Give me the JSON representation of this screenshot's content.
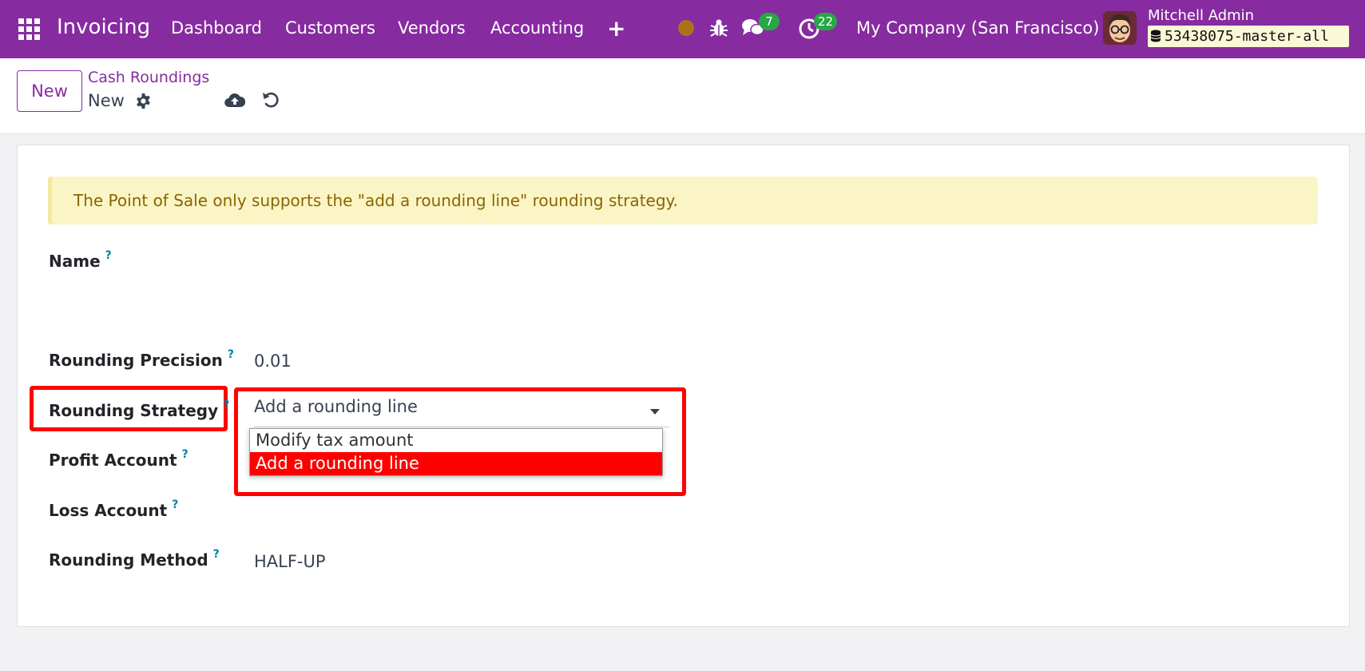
{
  "navbar": {
    "app_title": "Invoicing",
    "menu": [
      "Dashboard",
      "Customers",
      "Vendors",
      "Accounting"
    ],
    "plus_label": "+",
    "messages_count": "7",
    "activities_count": "22",
    "company": "My Company (San Francisco)",
    "user_name": "Mitchell Admin",
    "database": "53438075-master-all",
    "status_color": "#a8741a",
    "brand_color": "#872ba0"
  },
  "control_panel": {
    "new_label": "New",
    "breadcrumb": "Cash Roundings",
    "record_name": "New"
  },
  "alert": {
    "text": "The Point of Sale only supports the \"add a rounding line\" rounding strategy."
  },
  "form": {
    "name_label": "Name",
    "precision_label": "Rounding Precision",
    "precision_value": "0.01",
    "strategy_label": "Rounding Strategy",
    "strategy_value": "Add a rounding line",
    "strategy_options": [
      "Modify tax amount",
      "Add a rounding line"
    ],
    "profit_label": "Profit Account",
    "loss_label": "Loss Account",
    "method_label": "Rounding Method",
    "method_value": "HALF-UP",
    "help_mark": "?"
  },
  "highlight_color": "#ff0000"
}
